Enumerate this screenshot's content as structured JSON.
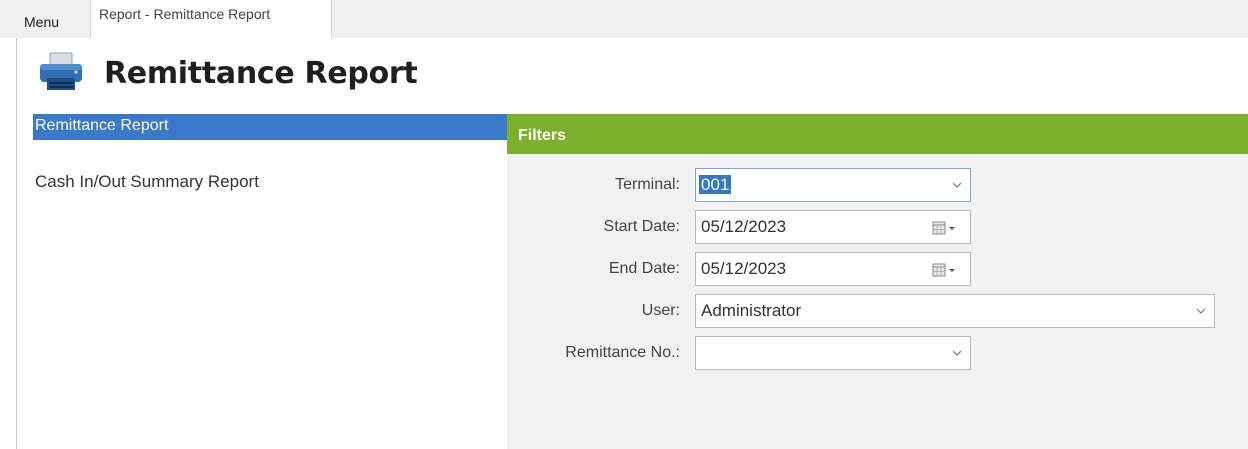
{
  "tabs": [
    {
      "label": "Menu"
    },
    {
      "label": "Report - Remittance Report"
    }
  ],
  "page": {
    "title": "Remittance Report",
    "icon": "printer-icon"
  },
  "nav": {
    "items": [
      {
        "label": "Remittance Report",
        "selected": true
      },
      {
        "label": "Cash In/Out Summary Report",
        "selected": false
      }
    ]
  },
  "filters": {
    "header": "Filters",
    "terminal": {
      "label": "Terminal:",
      "value": "001"
    },
    "start_date": {
      "label": "Start Date:",
      "value": "05/12/2023"
    },
    "end_date": {
      "label": "End Date:",
      "value": "05/12/2023"
    },
    "user": {
      "label": "User:",
      "value": "Administrator"
    },
    "remittance_no": {
      "label": "Remittance No.:",
      "value": ""
    }
  },
  "colors": {
    "accent_green": "#7bb02c",
    "selection_blue": "#3a78c9"
  }
}
